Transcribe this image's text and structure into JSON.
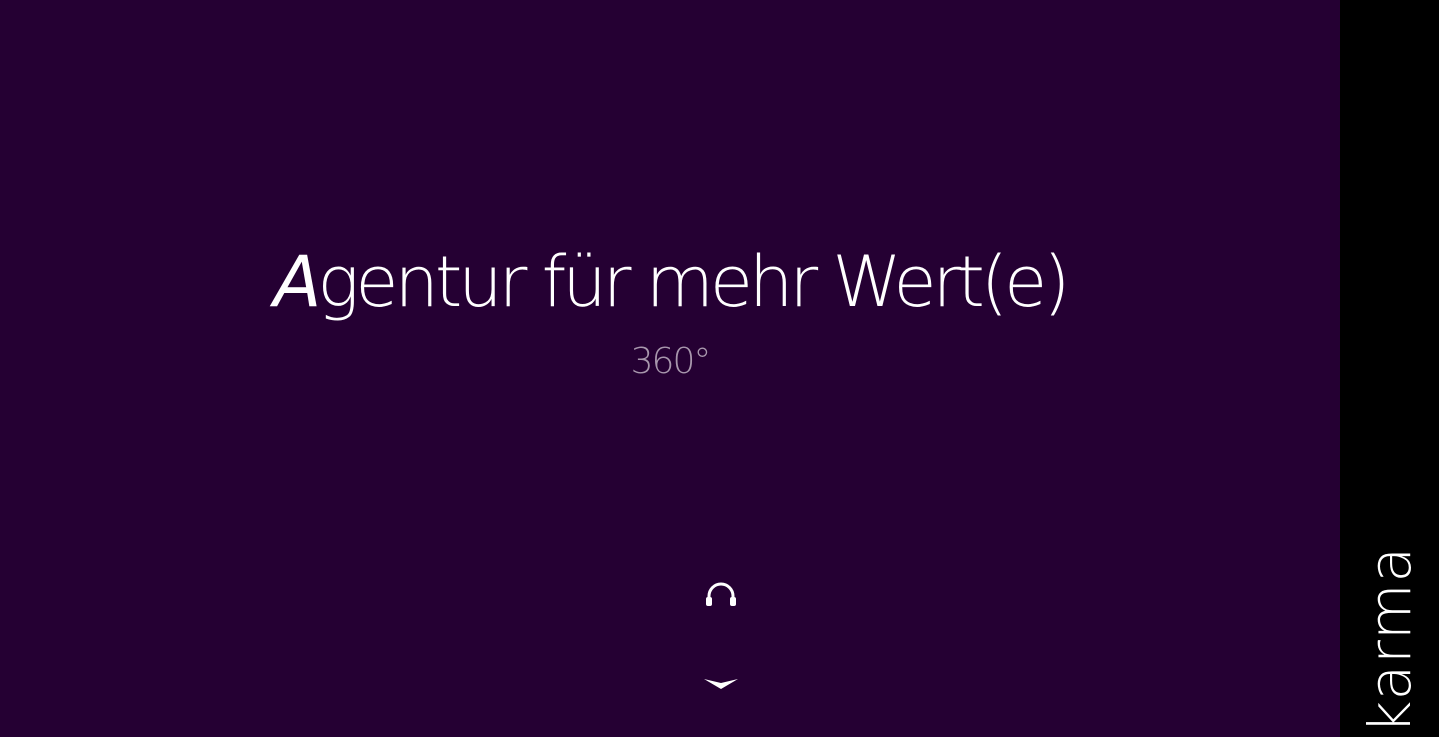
{
  "hero": {
    "headline_initial": "A",
    "headline_rest": "gentur für mehr Wert(e)",
    "subline": "360°",
    "audio_icon": "headphones-icon",
    "scroll_icon": "chevron-down-icon"
  },
  "sidebar": {
    "brand": "karma"
  },
  "colors": {
    "hero_background": "#250033",
    "sidebar_background": "#000000",
    "headline_text": "#ffffff",
    "subline_text": "#a897ad"
  }
}
